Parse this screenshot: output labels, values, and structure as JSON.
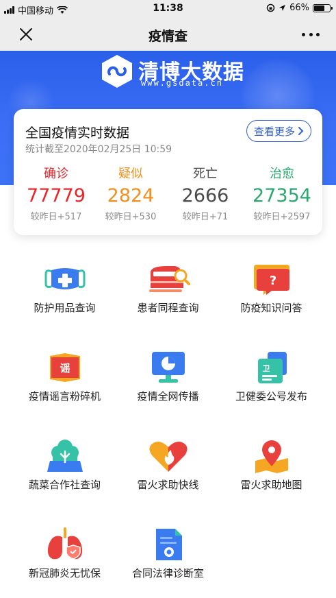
{
  "status_bar": {
    "carrier": "中国移动",
    "time": "11:38",
    "battery": "66%",
    "battery_level": 0.66
  },
  "nav": {
    "title": "疫情查"
  },
  "banner": {
    "brand_name": "清博大数据",
    "brand_url": "www.gsdata.cn"
  },
  "card": {
    "title": "全国疫情实时数据",
    "subtitle": "统计截至2020年02月25日 10:59",
    "more_label": "查看更多",
    "stats": [
      {
        "label": "确诊",
        "value": "77779",
        "delta": "较昨日+517",
        "color": "#e8262a"
      },
      {
        "label": "疑似",
        "value": "2824",
        "delta": "较昨日+530",
        "color": "#f0901e"
      },
      {
        "label": "死亡",
        "value": "2666",
        "delta": "较昨日+71",
        "color": "#4a4a4a"
      },
      {
        "label": "治愈",
        "value": "27354",
        "delta": "较昨日+2597",
        "color": "#2ba86f"
      }
    ]
  },
  "services": [
    {
      "label": "防护用品查询",
      "icon": "mask-icon"
    },
    {
      "label": "患者同程查询",
      "icon": "train-search-icon"
    },
    {
      "label": "防疫知识问答",
      "icon": "question-chat-icon"
    },
    {
      "label": "疫情谣言粉碎机",
      "icon": "rumor-book-icon"
    },
    {
      "label": "疫情全网传播",
      "icon": "monitor-chart-icon"
    },
    {
      "label": "卫健委公号发布",
      "icon": "publish-doc-icon"
    },
    {
      "label": "蔬菜合作社查询",
      "icon": "vegetable-cloud-icon"
    },
    {
      "label": "雷火求助快线",
      "icon": "fire-heart-icon"
    },
    {
      "label": "雷火求助地图",
      "icon": "map-pin-icon"
    },
    {
      "label": "新冠肺炎无忧保",
      "icon": "lungs-shield-icon"
    },
    {
      "label": "合同法律诊断室",
      "icon": "contract-doc-icon"
    }
  ]
}
